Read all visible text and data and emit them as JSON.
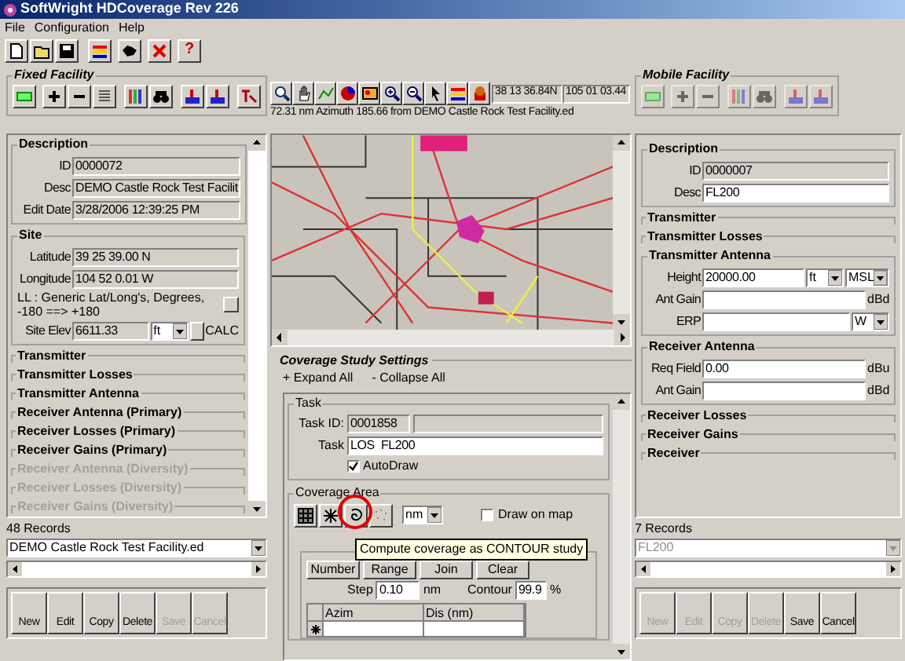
{
  "window": {
    "title": "SoftWright HDCoverage Rev 226"
  },
  "menu": [
    {
      "label": "File"
    },
    {
      "label": "Configuration"
    },
    {
      "label": "Help"
    }
  ],
  "toolbar": {
    "help": "?"
  },
  "fixed_facility": {
    "title": "Fixed Facility",
    "sections": [
      {
        "kind": "group",
        "title": "Description",
        "fields": [
          {
            "kind": "text",
            "label": "ID",
            "value": "0000072",
            "readonly": true
          },
          {
            "kind": "text",
            "label": "Desc",
            "value": "DEMO Castle Rock Test Facilit",
            "readonly": true
          },
          {
            "kind": "text",
            "label": "Edit Date",
            "value": "3/28/2006 12:39:25 PM",
            "readonly": true
          }
        ]
      },
      {
        "kind": "group",
        "title": "Site",
        "fields": [
          {
            "kind": "text",
            "label": "Latitude",
            "value": "39 25 39.00 N",
            "readonly": true
          },
          {
            "kind": "text",
            "label": "Longitude",
            "value": "104 52 0.01 W",
            "readonly": true
          },
          {
            "kind": "note",
            "label": "LL : Generic Lat/Long's, Degrees, -180 ==> +180"
          },
          {
            "kind": "text",
            "label": "Site Elev",
            "value": "6611.33",
            "readonly": true,
            "selects": [
              "ft"
            ],
            "action": "CALC"
          }
        ]
      },
      {
        "kind": "collapsed",
        "title": "Transmitter",
        "disabled": false
      },
      {
        "kind": "collapsed",
        "title": "Transmitter Losses",
        "disabled": false
      },
      {
        "kind": "collapsed",
        "title": "Transmitter Antenna",
        "disabled": false
      },
      {
        "kind": "collapsed",
        "title": "Receiver Antenna (Primary)",
        "disabled": false
      },
      {
        "kind": "collapsed",
        "title": "Receiver Losses (Primary)",
        "disabled": false
      },
      {
        "kind": "collapsed",
        "title": "Receiver Gains (Primary)",
        "disabled": false
      },
      {
        "kind": "collapsed",
        "title": "Receiver Antenna (Diversity)",
        "disabled": true
      },
      {
        "kind": "collapsed",
        "title": "Receiver Losses (Diversity)",
        "disabled": true
      },
      {
        "kind": "collapsed",
        "title": "Receiver Gains (Diversity)",
        "disabled": true
      }
    ],
    "records": "48 Records",
    "selector": {
      "value": "DEMO Castle Rock Test Facility.ed",
      "disabled": false
    },
    "buttons": [
      {
        "label": "New",
        "disabled": false
      },
      {
        "label": "Edit",
        "disabled": false
      },
      {
        "label": "Copy",
        "disabled": false
      },
      {
        "label": "Delete",
        "disabled": false
      },
      {
        "label": "Save",
        "disabled": true
      },
      {
        "label": "Cancel",
        "disabled": true
      }
    ]
  },
  "map_panel": {
    "latitude": "38 13 36.84N",
    "longitude": "105 01 03.44",
    "status": "72.31 nm Azimuth 185.66 from DEMO Castle Rock Test Facility.ed"
  },
  "coverage_study": {
    "title": "Coverage Study Settings",
    "expand": "+ Expand All",
    "collapse": "- Collapse All",
    "task": {
      "title": "Task",
      "task_id_label": "Task ID:",
      "task_id": "0001858",
      "task_label": "Task",
      "task": "LOS  FL200",
      "autodraw": {
        "label": "AutoDraw",
        "checked": true
      }
    },
    "coverage_area": {
      "title": "Coverage Area",
      "unit": "nm",
      "draw_on_map": {
        "label": "Draw on map",
        "checked": false
      },
      "buttons": [
        {
          "label": "Number"
        },
        {
          "label": "Range"
        },
        {
          "label": "Join"
        },
        {
          "label": "Clear"
        }
      ],
      "step_label": "Step",
      "step": "0.10",
      "step_unit": "nm",
      "contour_label": "Contour",
      "contour": "99.9",
      "contour_unit": "%",
      "columns": [
        "Azim",
        "Dis (nm)"
      ]
    },
    "tooltip": "Compute coverage as CONTOUR study"
  },
  "mobile_facility": {
    "title": "Mobile Facility",
    "sections": [
      {
        "kind": "group",
        "title": "Description",
        "fields": [
          {
            "kind": "text",
            "label": "ID",
            "value": "0000007",
            "readonly": true
          },
          {
            "kind": "text",
            "label": "Desc",
            "value": "FL200",
            "readonly": false
          }
        ]
      },
      {
        "kind": "collapsed",
        "title": "Transmitter",
        "disabled": false
      },
      {
        "kind": "collapsed",
        "title": "Transmitter Losses",
        "disabled": false
      },
      {
        "kind": "group",
        "title": "Transmitter Antenna",
        "fields": [
          {
            "kind": "text",
            "label": "Height",
            "value": "20000.00",
            "readonly": false,
            "selects": [
              "ft",
              "MSL"
            ]
          },
          {
            "kind": "text",
            "label": "Ant Gain",
            "readonly": false,
            "unit": "dBd"
          },
          {
            "kind": "text",
            "label": "ERP",
            "readonly": false,
            "selects": [
              "W"
            ]
          }
        ]
      },
      {
        "kind": "group",
        "title": "Receiver Antenna",
        "fields": [
          {
            "kind": "text",
            "label": "Req Field",
            "value": "0.00",
            "readonly": false,
            "unit": "dBu"
          },
          {
            "kind": "text",
            "label": "Ant Gain",
            "readonly": false,
            "unit": "dBd"
          }
        ]
      },
      {
        "kind": "collapsed",
        "title": "Receiver Losses",
        "disabled": false
      },
      {
        "kind": "collapsed",
        "title": "Receiver Gains",
        "disabled": false
      },
      {
        "kind": "collapsed",
        "title": "Receiver",
        "disabled": false
      }
    ],
    "records": "7 Records",
    "selector": {
      "value": "FL200",
      "disabled": true
    },
    "buttons": [
      {
        "label": "New",
        "disabled": true
      },
      {
        "label": "Edit",
        "disabled": true
      },
      {
        "label": "Copy",
        "disabled": true
      },
      {
        "label": "Delete",
        "disabled": true
      },
      {
        "label": "Save",
        "disabled": false
      },
      {
        "label": "Cancel",
        "disabled": false
      }
    ]
  }
}
